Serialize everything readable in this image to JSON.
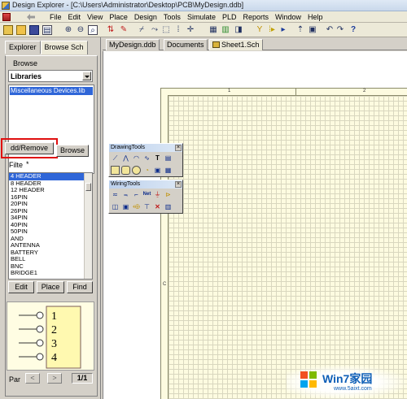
{
  "window": {
    "title": "Design Explorer - [C:\\Users\\Administrator\\Desktop\\PCB\\MyDesign.ddb]"
  },
  "menu": [
    "File",
    "Edit",
    "View",
    "Place",
    "Design",
    "Tools",
    "Simulate",
    "PLD",
    "Reports",
    "Window",
    "Help"
  ],
  "left_panel": {
    "tabs": [
      "Explorer",
      "Browse Sch"
    ],
    "browse_label": "Browse",
    "browse_select": "Libraries",
    "libraries": [
      "Miscellaneous Devices.lib"
    ],
    "add_remove_button": "dd/Remove",
    "browse_button": "Browse",
    "filter_label": "Filte",
    "filter_value": "*",
    "parts": [
      "4 HEADER",
      "8 HEADER",
      "12 HEADER",
      "16PIN",
      "20PIN",
      "26PIN",
      "34PIN",
      "40PIN",
      "50PIN",
      "AND",
      "ANTENNA",
      "BATTERY",
      "BELL",
      "BNC",
      "BRIDGE1"
    ],
    "selected_part": "4 HEADER",
    "edit_button": "Edit",
    "place_button": "Place",
    "find_button": "Find",
    "preview_pins": [
      "1",
      "2",
      "3",
      "4"
    ],
    "part_label": "Par",
    "prev_symbol": "<",
    "next_symbol": ">",
    "page": "1/1"
  },
  "doc_tabs": [
    "MyDesign.ddb",
    "Documents",
    "Sheet1.Sch"
  ],
  "drawing_tools": {
    "title": "DrawingTools",
    "close": "×"
  },
  "wiring_tools": {
    "title": "WiringTools",
    "close": "×"
  },
  "sheet": {
    "col_labels": [
      "1",
      "2"
    ],
    "row_labels": [
      "C"
    ]
  },
  "watermark": {
    "brand": "Win7家园",
    "site": "www.5aixt.com"
  },
  "colors": {
    "selection": "#2f66d8",
    "highlight_box": "#e01010",
    "sheet_bg": "#fdfbe0",
    "preview_bg": "#fffde3"
  },
  "icons": [
    "open-folder-icon",
    "save-icon",
    "print-icon",
    "zoom-in-icon",
    "zoom-out-icon",
    "zoom-fit-icon",
    "wire-icon",
    "undo-icon",
    "redo-icon",
    "help-icon"
  ]
}
